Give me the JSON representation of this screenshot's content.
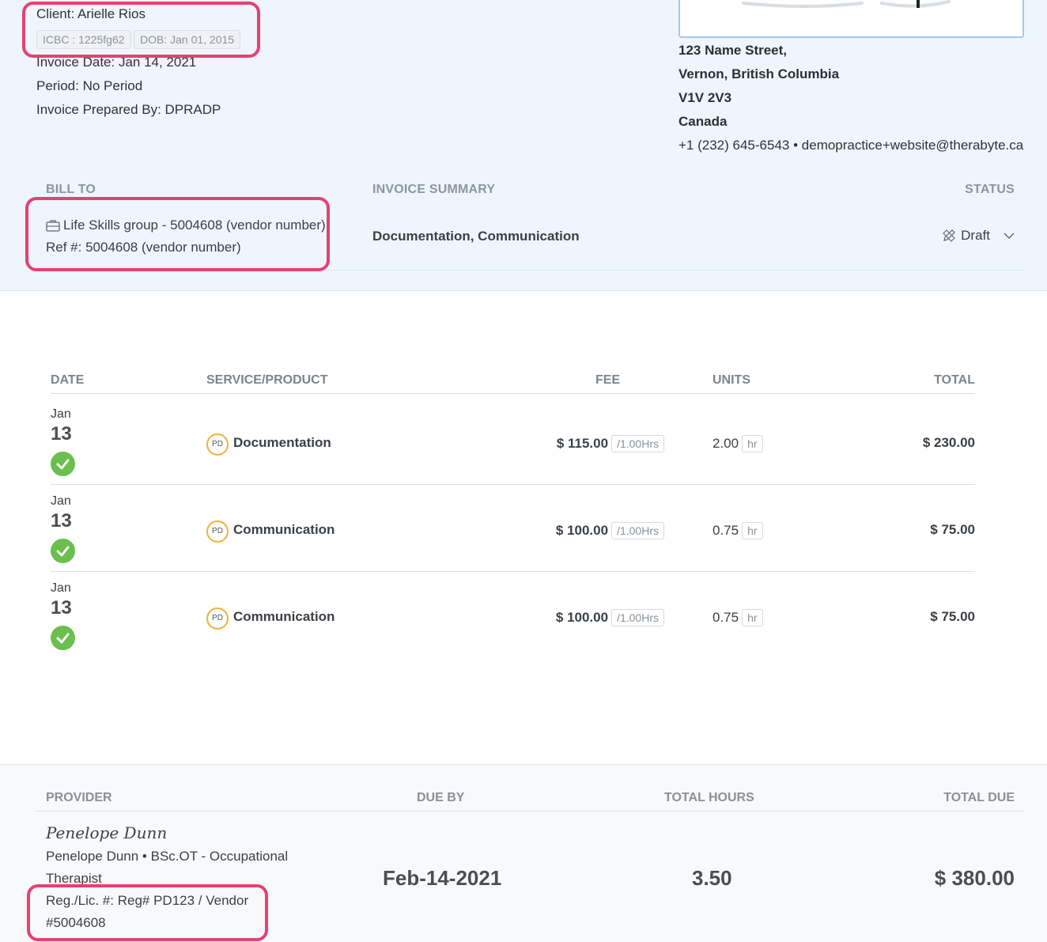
{
  "client": {
    "name_line": "Client: Arielle Rios",
    "icbc_pill": "ICBC : 1225fg62",
    "dob_pill": "DOB: Jan 01, 2015",
    "invoice_date": "Invoice Date: Jan 14, 2021",
    "period": "Period: No Period",
    "prepared_by": "Invoice Prepared By: DPRADP"
  },
  "practice": {
    "street": "123 Name Street,",
    "city": "Vernon, British Columbia",
    "postal": "V1V 2V3",
    "country": "Canada",
    "phone": "+1 (232) 645-6543",
    "separator": "•",
    "email": "demopractice+website@therabyte.ca"
  },
  "bill_section": {
    "bill_to_heading": "BILL TO",
    "summary_heading": "INVOICE SUMMARY",
    "status_heading": "STATUS",
    "payer": "Life Skills group - 5004608 (vendor number)",
    "ref": "Ref #: 5004608 (vendor number)",
    "summary": "Documentation, Communication",
    "status": "Draft"
  },
  "table": {
    "headers": {
      "date": "DATE",
      "service": "SERVICE/PRODUCT",
      "fee": "FEE",
      "units": "UNITS",
      "total": "TOTAL"
    },
    "rows": [
      {
        "month": "Jan",
        "day": "13",
        "badge": "PD",
        "service": "Documentation",
        "fee": "$ 115.00",
        "fee_unit": "/1.00Hrs",
        "units": "2.00",
        "unit_label": "hr",
        "total": "$ 230.00"
      },
      {
        "month": "Jan",
        "day": "13",
        "badge": "PD",
        "service": "Communication",
        "fee": "$ 100.00",
        "fee_unit": "/1.00Hrs",
        "units": "0.75",
        "unit_label": "hr",
        "total": "$ 75.00"
      },
      {
        "month": "Jan",
        "day": "13",
        "badge": "PD",
        "service": "Communication",
        "fee": "$ 100.00",
        "fee_unit": "/1.00Hrs",
        "units": "0.75",
        "unit_label": "hr",
        "total": "$ 75.00"
      }
    ]
  },
  "footer": {
    "provider_heading": "PROVIDER",
    "due_heading": "DUE BY",
    "hours_heading": "TOTAL HOURS",
    "total_due_heading": "TOTAL DUE",
    "signature": "Penelope Dunn",
    "provider_details": "Penelope Dunn • BSc.OT - Occupational Therapist",
    "reg_lic": "Reg./Lic. #: Reg# PD123 / Vendor #5004608",
    "due_date": "Feb-14-2021",
    "total_hours": "3.50",
    "total_due": "$ 380.00"
  },
  "colors": {
    "header_bg": "#eef5fd",
    "highlight": "#e5426f",
    "check_green": "#6bbf4e",
    "badge_orange": "#f0b13d"
  },
  "icons": [
    "briefcase-icon",
    "pencil-ruler-icon",
    "chevron-down-icon",
    "check-circle-icon"
  ]
}
